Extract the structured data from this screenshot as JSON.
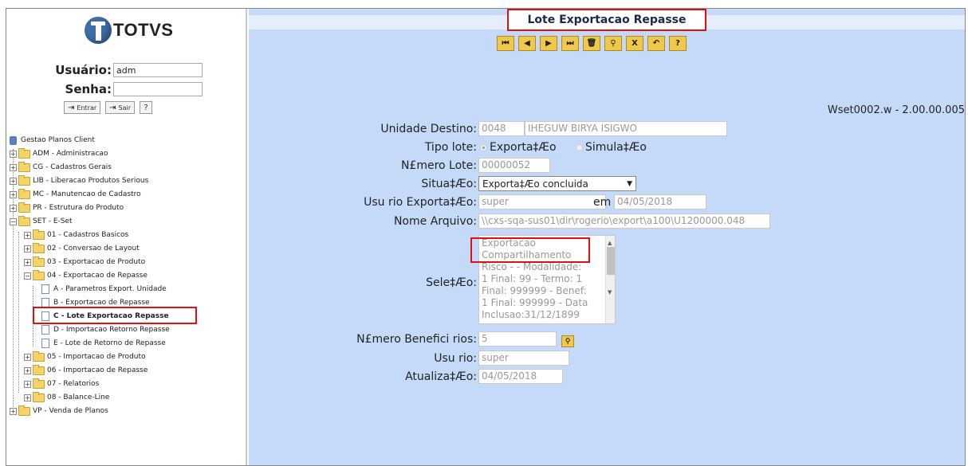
{
  "brand": {
    "name": "TOTVS"
  },
  "login": {
    "user_label": "Usuário:",
    "user_value": "adm",
    "password_label": "Senha:",
    "password_value": "",
    "enter_label": "Entrar",
    "exit_label": "Sair",
    "help_label": "?"
  },
  "tree": {
    "root": "Gestao Planos Client",
    "items": [
      {
        "label": "ADM - Administracao"
      },
      {
        "label": "CG - Cadastros Gerais"
      },
      {
        "label": "LIB - Liberacao Produtos Serious"
      },
      {
        "label": "MC - Manutencao de Cadastro"
      },
      {
        "label": "PR - Estrutura do Produto"
      },
      {
        "label": "SET - E-Set"
      },
      {
        "label": "01 - Cadastros Basicos"
      },
      {
        "label": "02 - Conversao de Layout"
      },
      {
        "label": "03 - Exportacao de Produto"
      },
      {
        "label": "04 - Exportacao de Repasse"
      },
      {
        "label": "A - Parametros Export. Unidade"
      },
      {
        "label": "B - Exportacao de Repasse"
      },
      {
        "label": "C - Lote Exportacao Repasse"
      },
      {
        "label": "D - Importacao Retorno Repasse"
      },
      {
        "label": "E - Lote de Retorno de Repasse"
      },
      {
        "label": "05 - Importacao de Produto"
      },
      {
        "label": "06 - Importacao de Repasse"
      },
      {
        "label": "07 - Relatorios"
      },
      {
        "label": "08 - Balance-Line"
      },
      {
        "label": "VP - Venda de Planos"
      }
    ]
  },
  "page": {
    "title": "Lote Exportacao Repasse",
    "version": "Wset0002.w - 2.00.00.005"
  },
  "toolbar": {
    "first": "first-record-icon",
    "prev": "previous-record-icon",
    "next": "next-record-icon",
    "last": "last-record-icon",
    "delete": "trash-icon",
    "search": "search-icon",
    "cancel_glyph": "X",
    "undo": "undo-icon",
    "help_glyph": "?"
  },
  "form": {
    "unidade_label": "Unidade Destino:",
    "unidade_code": "0048",
    "unidade_name": "IHEGUW BIRYA ISIGWO",
    "tipo_label": "Tipo lote:",
    "tipo_opt1": "Exporta‡Æo",
    "tipo_opt2": "Simula‡Æo",
    "numero_label": "N£mero Lote:",
    "numero_value": "00000052",
    "situacao_label": "Situa‡Æo:",
    "situacao_value": "Exporta‡Æo concluida",
    "usuario_exp_label": "Usu rio Exporta‡Æo:",
    "usuario_exp_value": "super",
    "em_label": "em",
    "em_value": "04/05/2018",
    "arquivo_label": "Nome Arquivo:",
    "arquivo_value": "\\\\cxs-sqa-sus01\\dir\\rogerio\\export\\a100\\U1200000.048",
    "selecao_label": "Sele‡Æo:",
    "selecao_lines": [
      "Exportacao",
      "Compartilhamento",
      "Risco -  - Modalidade:",
      "1 Final: 99 - Termo: 1",
      "Final: 999999 - Benef:",
      "1 Final: 999999 - Data",
      "Inclusao:31/12/1899"
    ],
    "beneficiarios_label": "N£mero Benefici rios:",
    "beneficiarios_value": "5",
    "usuario_label": "Usu rio:",
    "usuario_value": "super",
    "atualizacao_label": "Atualiza‡Æo:",
    "atualizacao_value": "04/05/2018"
  },
  "colors": {
    "panel_bg": "#c5daf9",
    "highlight": "#e01010",
    "toolbar_btn": "#f0c84a"
  }
}
